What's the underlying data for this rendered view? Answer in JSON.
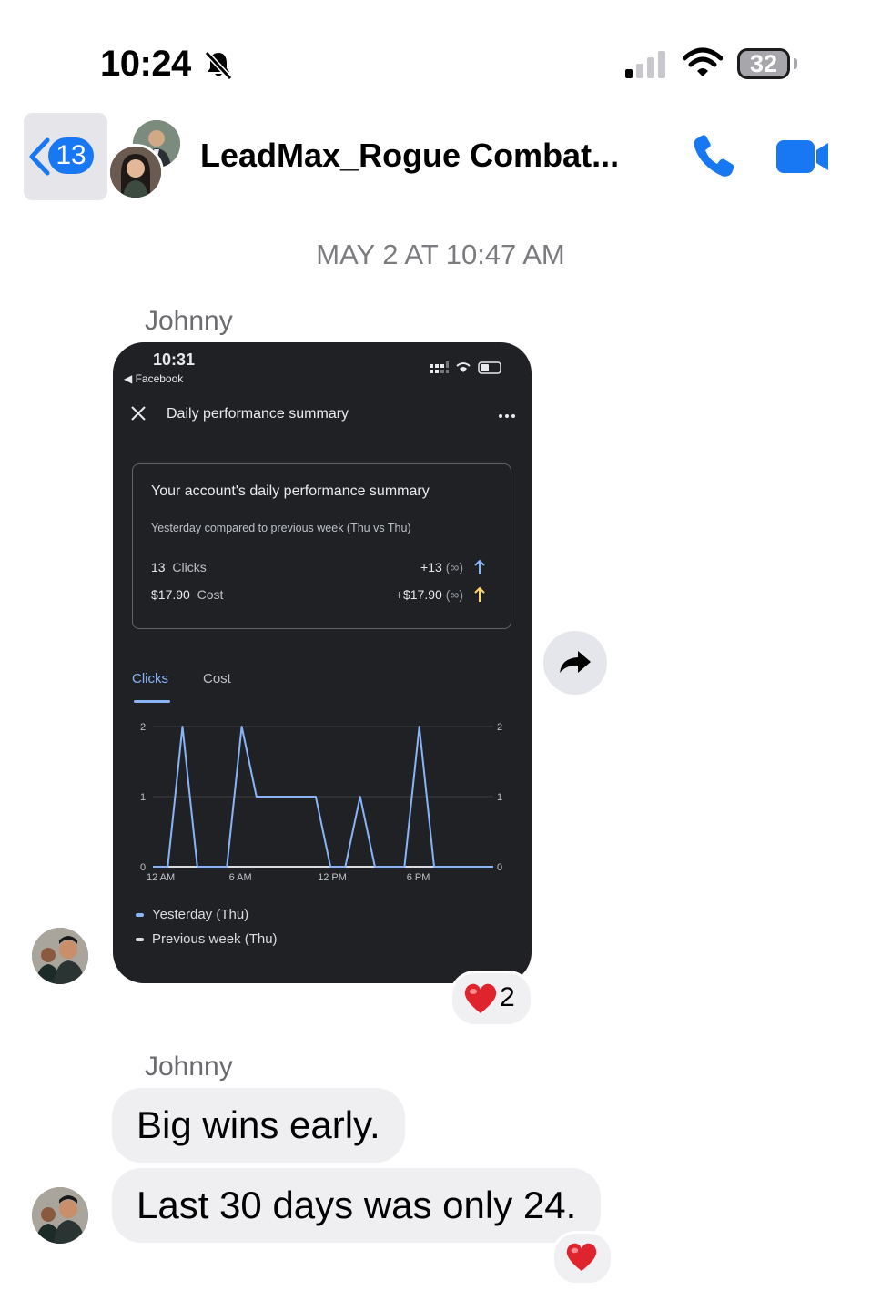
{
  "status_bar": {
    "time": "10:24",
    "battery": "32",
    "icons": [
      "bell-slash-icon",
      "cellular-signal-icon",
      "wifi-icon",
      "battery-icon"
    ]
  },
  "header": {
    "back_count": "13",
    "title": "LeadMax_Rogue Combat...",
    "icons": [
      "back-chevron-icon",
      "phone-icon",
      "video-camera-icon"
    ],
    "accent_color": "#1877f2"
  },
  "date_stamp": "MAY 2 AT 10:47 AM",
  "messages": [
    {
      "sender": "Johnny",
      "type": "image",
      "reaction": {
        "emoji": "❤️",
        "count": "2"
      },
      "screenshot": {
        "time": "10:31",
        "back_label": "◀ Facebook",
        "page_title": "Daily performance summary",
        "card": {
          "title": "Your account's daily performance summary",
          "subtitle": "Yesterday compared to previous week (Thu vs Thu)",
          "rows": [
            {
              "value": "13",
              "label": "Clicks",
              "change": "+13",
              "change_note": "(∞)",
              "arrow_color": "#8ab4f8"
            },
            {
              "value": "$17.90",
              "label": "Cost",
              "change": "+$17.90",
              "change_note": "(∞)",
              "arrow_color": "#fdd663"
            }
          ]
        },
        "tabs": [
          "Clicks",
          "Cost"
        ],
        "active_tab": "Clicks",
        "legend": [
          "Yesterday (Thu)",
          "Previous week (Thu)"
        ]
      }
    },
    {
      "sender": "Johnny",
      "type": "text",
      "lines": [
        "Big wins early.",
        "Last 30 days was only 24."
      ],
      "reaction": {
        "emoji": "❤️"
      }
    }
  ],
  "chart_data": {
    "type": "line",
    "x": [
      0,
      1,
      2,
      3,
      4,
      5,
      6,
      7,
      8,
      9,
      10,
      11,
      12,
      13,
      14,
      15,
      16,
      17,
      18,
      19,
      20,
      21,
      22,
      23
    ],
    "x_tick_labels": [
      "12 AM",
      "6 AM",
      "12 PM",
      "6 PM"
    ],
    "x_tick_positions": [
      0,
      6,
      12,
      18
    ],
    "ylim": [
      0,
      2
    ],
    "y_ticks": [
      0,
      1,
      2
    ],
    "grid": true,
    "legend_position": "bottom-left",
    "series": [
      {
        "name": "Yesterday (Thu)",
        "color": "#8ab4f8",
        "values": [
          0,
          0,
          2,
          0,
          0,
          0,
          2,
          1,
          1,
          1,
          1,
          1,
          0,
          0,
          1,
          0,
          0,
          0,
          2,
          0,
          0,
          0,
          0,
          0
        ]
      },
      {
        "name": "Previous week (Thu)",
        "color": "#dadce0",
        "values": [
          0,
          0,
          0,
          0,
          0,
          0,
          0,
          0,
          0,
          0,
          0,
          0,
          0,
          0,
          0,
          0,
          0,
          0,
          0,
          0,
          0,
          0,
          0,
          0
        ]
      }
    ]
  }
}
